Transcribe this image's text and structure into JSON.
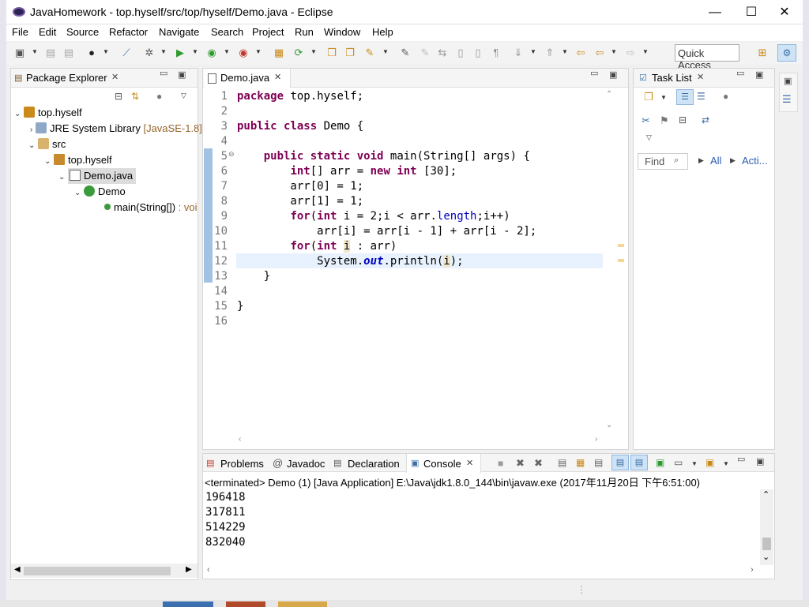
{
  "window": {
    "title": "JavaHomework - top.hyself/src/top/hyself/Demo.java - Eclipse",
    "minimize": "—",
    "maximize": "☐",
    "close": "✕"
  },
  "menu": [
    "File",
    "Edit",
    "Source",
    "Refactor",
    "Navigate",
    "Search",
    "Project",
    "Run",
    "Window",
    "Help"
  ],
  "toolbar": {
    "quick_access": "Quick Access"
  },
  "package_explorer": {
    "tab": "Package Explorer",
    "tree": [
      {
        "label": "top.hyself",
        "extra": ""
      },
      {
        "label": "JRE System Library",
        "extra": "[JavaSE-1.8]"
      },
      {
        "label": "src",
        "extra": ""
      },
      {
        "label": "top.hyself",
        "extra": ""
      },
      {
        "label": "Demo.java",
        "extra": ""
      },
      {
        "label": "Demo",
        "extra": ""
      },
      {
        "label": "main(String[])",
        "extra": ": void"
      }
    ]
  },
  "editor": {
    "tab": "Demo.java",
    "line_numbers": [
      "1",
      "2",
      "3",
      "4",
      "5",
      "6",
      "7",
      "8",
      "9",
      "10",
      "11",
      "12",
      "13",
      "14",
      "15",
      "16"
    ],
    "code": {
      "l1_kw": "package",
      "l1_rest": " top.hyself;",
      "l3_kw1": "public",
      "l3_kw2": "class",
      "l3_rest": " Demo {",
      "l5_ind": "    ",
      "l5_kw1": "public",
      "l5_kw2": "static",
      "l5_kw3": "void",
      "l5_rest": " main(String[] args) {",
      "l6_ind": "        ",
      "l6_kw1": "int",
      "l6_mid": "[] arr = ",
      "l6_kw2": "new",
      "l6_kw3": "int",
      "l6_rest": " [30];",
      "l7": "        arr[0] = 1;",
      "l8": "        arr[1] = 1;",
      "l9_ind": "        ",
      "l9_kw1": "for",
      "l9_a": "(",
      "l9_kw2": "int",
      "l9_b": " i = 2;i < arr.",
      "l9_fld": "length",
      "l9_c": ";i++)",
      "l10": "            arr[i] = arr[i - 1] + arr[i - 2];",
      "l11_ind": "        ",
      "l11_kw1": "for",
      "l11_a": "(",
      "l11_kw2": "int",
      "l11_sp": " ",
      "l11_var": "i",
      "l11_rest": " : arr)",
      "l12_ind": "            System.",
      "l12_st": "out",
      "l12_mid": ".println(",
      "l12_var": "i",
      "l12_rest": ");",
      "l13": "    }",
      "l15": "}"
    }
  },
  "task_list": {
    "tab": "Task List",
    "find_placeholder": "Find",
    "all": "All",
    "activate": "Acti..."
  },
  "bottom_tabs": [
    "Problems",
    "Javadoc",
    "Declaration",
    "Console"
  ],
  "console": {
    "header": "<terminated> Demo (1) [Java Application] E:\\Java\\jdk1.8.0_144\\bin\\javaw.exe (2017年11月20日 下午6:51:00)",
    "lines": [
      "196418",
      "317811",
      "514229",
      "832040"
    ]
  },
  "colors": {
    "keyword": "#7f0055",
    "field": "#0000c0",
    "accent": "#a2c2e4"
  }
}
